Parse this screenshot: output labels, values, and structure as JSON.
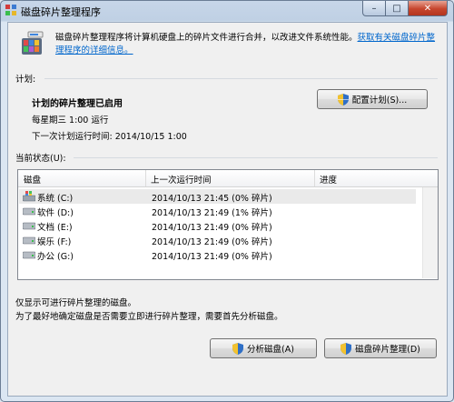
{
  "window": {
    "title": "磁盘碎片整理程序",
    "controls": {
      "minimize": "–",
      "maximize": "□",
      "close": "✕"
    }
  },
  "intro": {
    "text": "磁盘碎片整理程序将计算机硬盘上的碎片文件进行合并，以改进文件系统性能。",
    "link": "获取有关磁盘碎片整理程序的详细信息。"
  },
  "schedule": {
    "section_label": "计划:",
    "status": "计划的碎片整理已启用",
    "frequency": "每星期三  1:00 运行",
    "next_run": "下一次计划运行时间: 2014/10/15 1:00",
    "configure_button": "配置计划(S)..."
  },
  "current_status": {
    "section_label": "当前状态(U):",
    "columns": [
      "磁盘",
      "上一次运行时间",
      "进度"
    ],
    "rows": [
      {
        "disk": "系统 (C:)",
        "last_run": "2014/10/13 21:45 (0% 碎片)",
        "progress": "",
        "icon": "system-drive-icon"
      },
      {
        "disk": "软件 (D:)",
        "last_run": "2014/10/13 21:49 (1% 碎片)",
        "progress": "",
        "icon": "hard-drive-icon"
      },
      {
        "disk": "文档 (E:)",
        "last_run": "2014/10/13 21:49 (0% 碎片)",
        "progress": "",
        "icon": "hard-drive-icon"
      },
      {
        "disk": "娱乐 (F:)",
        "last_run": "2014/10/13 21:49 (0% 碎片)",
        "progress": "",
        "icon": "hard-drive-icon"
      },
      {
        "disk": "办公 (G:)",
        "last_run": "2014/10/13 21:49 (0% 碎片)",
        "progress": "",
        "icon": "hard-drive-icon"
      }
    ]
  },
  "notes": {
    "line1": "仅显示可进行碎片整理的磁盘。",
    "line2": "为了最好地确定磁盘是否需要立即进行碎片整理，需要首先分析磁盘。"
  },
  "actions": {
    "analyze_button": "分析磁盘(A)",
    "defrag_button": "磁盘碎片整理(D)"
  },
  "colors": {
    "link": "#0066cc",
    "close_button": "#c6452d",
    "shield_blue": "#2f6fc6",
    "shield_yellow": "#f2c230"
  }
}
